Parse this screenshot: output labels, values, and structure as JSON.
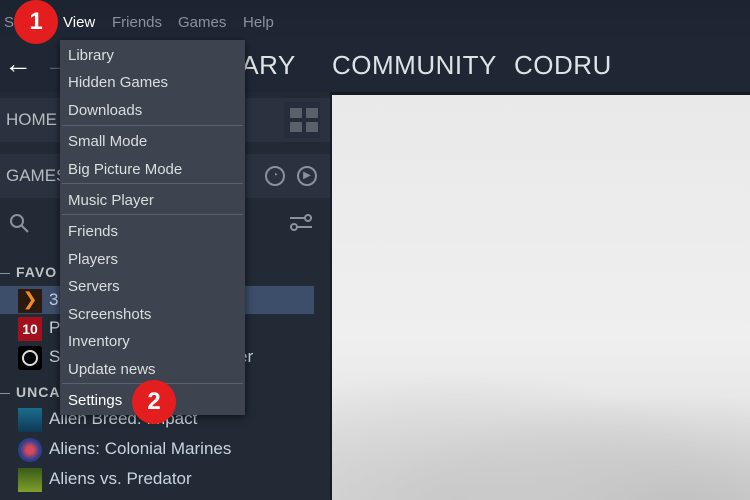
{
  "menubar": [
    "St",
    "View",
    "Friends",
    "Games",
    "Help"
  ],
  "nav": {
    "tabs": [
      "RARY",
      "COMMUNITY",
      "CODRU"
    ]
  },
  "left": {
    "home": "HOME",
    "games": "GAMES",
    "sections": [
      "FAVO",
      "UNCA"
    ],
    "favorites": [
      {
        "name": "3",
        "icon": "orange-wings"
      },
      {
        "name": "P",
        "icon": "red-10"
      },
      {
        "name": "S",
        "tail": "er",
        "icon": "black-ring"
      }
    ],
    "uncategorized": [
      {
        "name": "Alien Breed: Impact",
        "icon": "blue-figure"
      },
      {
        "name": "Aliens: Colonial Marines",
        "icon": "blue-emblem"
      },
      {
        "name": "Aliens vs. Predator",
        "icon": "green-cover"
      }
    ]
  },
  "dropdown": {
    "items": [
      "Library",
      "Hidden Games",
      "Downloads",
      "Small Mode",
      "Big Picture Mode",
      "Music Player",
      "Friends",
      "Players",
      "Servers",
      "Screenshots",
      "Inventory",
      "Update news",
      "Settings"
    ]
  },
  "badges": [
    "1",
    "2"
  ],
  "colors": {
    "badge": "#e41e1e",
    "menu": "#3d4450",
    "selected": "#3d4e6a"
  }
}
